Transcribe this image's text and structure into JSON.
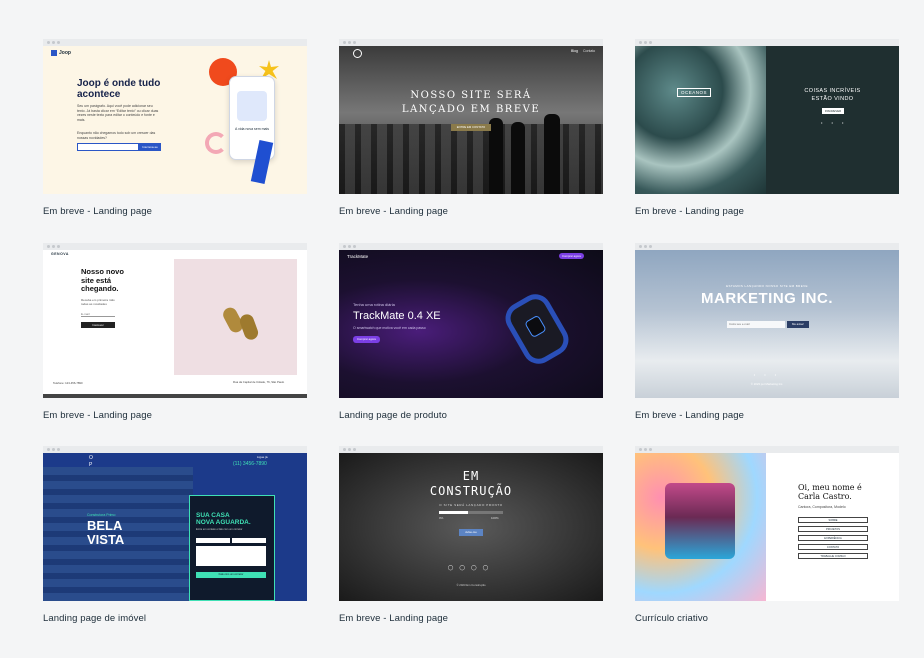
{
  "templates": [
    {
      "label": "Em breve - Landing page",
      "preview": {
        "brand": "Joop",
        "headline": "Joop é onde tudo acontece",
        "body": "Seu um parágrafo. Aqui você pode adicionar seu texto. Já basta clicar em “Editar texto” ou clicar duas vezes neste texto para editar o conteúdo e fonte e mais.",
        "signup_text": "Enquanto não chegamos todo sob um crescer das nossas novidades?",
        "button": "Inscreva-se",
        "card_text": "A vida nova sem mais"
      }
    },
    {
      "label": "Em breve - Landing page",
      "preview": {
        "headline_1": "NOSSO SITE SERÁ",
        "headline_2": "LANÇADO EM BREVE",
        "nav_1": "Blog",
        "nav_2": "Contato",
        "button": "ENTRE EM CONTATO"
      }
    },
    {
      "label": "Em breve - Landing page",
      "preview": {
        "badge": "OCEANOS",
        "headline_1": "COISAS INCRÍVEIS",
        "headline_2": "ESTÃO VINDO",
        "button": "INSCREVER"
      }
    },
    {
      "label": "Em breve - Landing page",
      "preview": {
        "brand": "GENOVA",
        "headline_1": "Nosso novo",
        "headline_2": "site está",
        "headline_3": "chegando.",
        "body": "Receba em primeira mão todas as novidades",
        "input_placeholder": "E-mail",
        "button": "Inscrever",
        "footer_left": "Telefone: 123-456-7890",
        "footer_right": "Rua da Capital de Cidade, 76, São Paulo"
      }
    },
    {
      "label": "Landing page de produto",
      "preview": {
        "brand": "TrackMate",
        "kicker": "Tenha uma rotina diária",
        "title": "TrackMate 0.4 XE",
        "subtitle": "O smartwatch que motiva você em cada passo",
        "button": "Comprar agora",
        "nav_button": "Comprar agora"
      }
    },
    {
      "label": "Em breve - Landing page",
      "preview": {
        "kicker": "ESTAMOS LANÇANDO NOSSO SITE EM BREVE",
        "title": "MARKETING INC.",
        "input_placeholder": "Insira seu e-mail",
        "button": "Me avise!",
        "footer": "© 2023 por Marketing Inc."
      }
    },
    {
      "label": "Landing page de imóvel",
      "preview": {
        "logo_1": "O",
        "logo_2": "P",
        "phone_label": "Ligue já",
        "phone": "(11) 3456-7890",
        "kicker": "Construtora Primo",
        "title_1": "BELA",
        "title_2": "VISTA",
        "form_title_1": "SUA CASA",
        "form_title_2": "NOVA AGUARDA.",
        "form_subtitle": "Entre em contato e fale com um corretor",
        "form_button": "Fale com um corretor"
      }
    },
    {
      "label": "Em breve - Landing page",
      "preview": {
        "title_1": "EM",
        "title_2": "CONSTRUÇÃO",
        "subtitle": "O SITE SERÁ LANÇADO PRONTO",
        "progress_start": "0%",
        "progress_end": "100%",
        "progress_value": 0.45,
        "button": "Avise-me",
        "footer": "© 2023 Em Construção"
      }
    },
    {
      "label": "Currículo criativo",
      "preview": {
        "name_line_1": "Oi, meu nome é",
        "name_line_2": "Carla Castro.",
        "role": "Cantora, Compositora, Modelo",
        "button_1": "SOBRE",
        "button_2": "PROJETOS",
        "button_3": "EXPERIÊNCIA",
        "button_4": "CONTATO",
        "button_5": "TRABALHE COMIGO"
      }
    }
  ]
}
